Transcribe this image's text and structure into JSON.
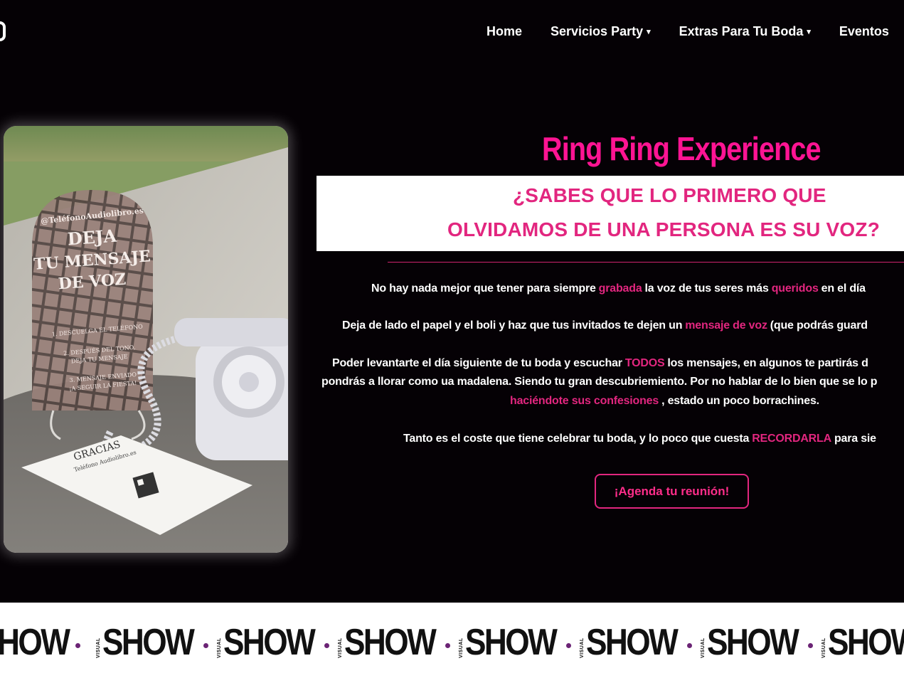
{
  "header": {
    "nav": [
      {
        "label": "Home",
        "has_dropdown": false
      },
      {
        "label": "Servicios Party",
        "has_dropdown": true
      },
      {
        "label": "Extras Para Tu Boda",
        "has_dropdown": true
      },
      {
        "label": "Eventos",
        "has_dropdown": false
      }
    ],
    "dropdown_glyph": "▾"
  },
  "hero": {
    "image": {
      "sign_handle": "@TeléfonoAudiolibro.es",
      "sign_title_1": "DEJA",
      "sign_title_2": "TU MENSAJE",
      "sign_title_3": "DE VOZ",
      "sign_step_1": "1. DESCUELGA EL TELÉFONO",
      "sign_step_2a": "2. DESPUÉS DEL TONO,",
      "sign_step_2b": "DEJA TU MENSAJE",
      "sign_step_3a": "3. MENSAJE ENVIADO",
      "sign_step_3b": "¡A SEGUIR LA FIESTA!",
      "card_title": "GRACIAS",
      "card_brand": "Teléfono Audiolibro.es"
    },
    "title": "Ring Ring Experience",
    "question_line_1": "¿SABES QUE LO PRIMERO QUE",
    "question_line_2": "OLVIDAMOS DE UNA PERSONA ES SU VOZ?",
    "p1": {
      "a": "No hay nada mejor que tener para siempre",
      "h1": "grabada",
      "b": "la voz de tus seres más",
      "h2": "queridos",
      "c": "en el día"
    },
    "p2": {
      "a": "Deja de lado el papel y el boli y haz que tus invitados te dejen un",
      "h1": "mensaje de voz",
      "b": "(que podrás guard"
    },
    "p3": {
      "line1_a": "Poder levantarte el día siguiente de tu boda y escuchar",
      "line1_h": "TODOS",
      "line1_b": "los mensajes, en algunos te partirás d",
      "line2": "pondrás a llorar como ua madalena. Siendo tu gran descubriemiento. Por no hablar de lo bien que se lo p",
      "line3_h": "haciéndote sus confesiones",
      "line3_b": ", estado un poco borrachines."
    },
    "p4": {
      "a": "Tanto es el coste que tiene celebrar tu boda, y lo poco que cuesta",
      "h1": "RECORDARLA",
      "b": "para sie"
    },
    "cta_label": "¡Agenda tu reunión!"
  },
  "marquee": {
    "logo_small": "VISUAL",
    "logo_big": "SHOW",
    "first_fragment": "HOW"
  },
  "colors": {
    "accent": "#e2267f",
    "title": "#ff1493",
    "background": "#050105"
  }
}
